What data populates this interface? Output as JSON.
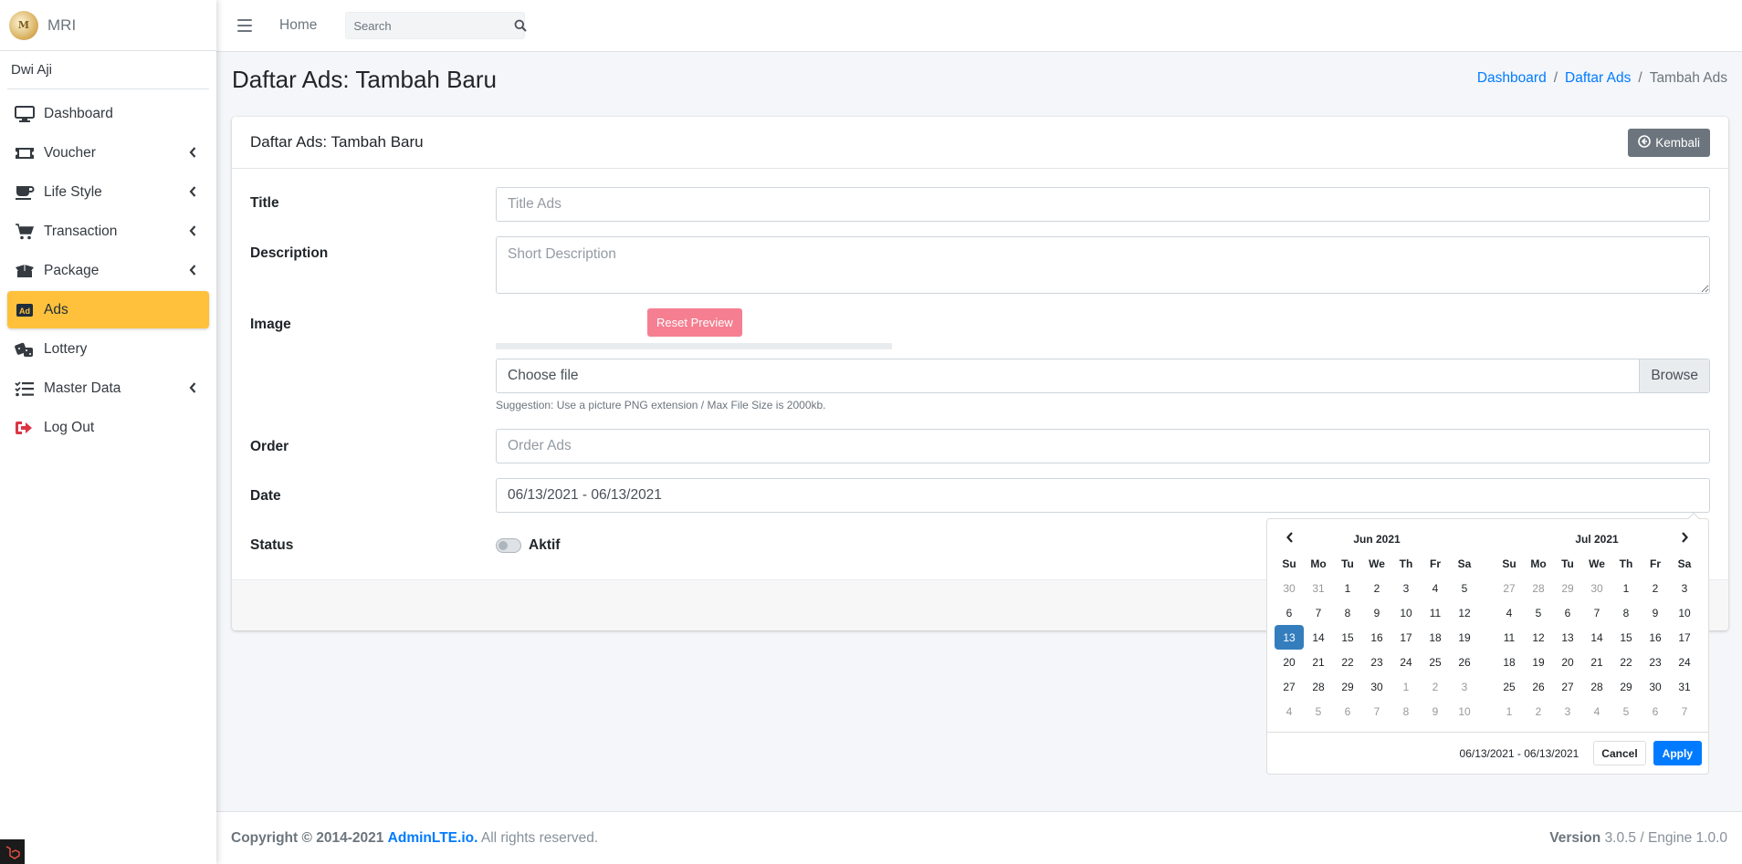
{
  "brand": {
    "name": "MRI",
    "logo_text": "M"
  },
  "user": {
    "name": "Dwi Aji"
  },
  "sidebar": {
    "items": [
      {
        "label": "Dashboard",
        "icon": "desktop-icon",
        "has_arrow": false
      },
      {
        "label": "Voucher",
        "icon": "ticket-icon",
        "has_arrow": true
      },
      {
        "label": "Life Style",
        "icon": "coffee-icon",
        "has_arrow": true
      },
      {
        "label": "Transaction",
        "icon": "cart-icon",
        "has_arrow": true
      },
      {
        "label": "Package",
        "icon": "box-open-icon",
        "has_arrow": true
      },
      {
        "label": "Ads",
        "icon": "ad-icon",
        "has_arrow": false,
        "active": true
      },
      {
        "label": "Lottery",
        "icon": "dice-icon",
        "has_arrow": false
      },
      {
        "label": "Master Data",
        "icon": "tasks-icon",
        "has_arrow": true
      },
      {
        "label": "Log Out",
        "icon": "sign-out-icon",
        "has_arrow": false
      }
    ]
  },
  "topbar": {
    "home_label": "Home",
    "search_placeholder": "Search"
  },
  "page": {
    "title": "Daftar Ads: Tambah Baru",
    "breadcrumb": [
      "Dashboard",
      "Daftar Ads",
      "Tambah Ads"
    ]
  },
  "card": {
    "title": "Daftar Ads: Tambah Baru",
    "back_label": "Kembali"
  },
  "form": {
    "title_label": "Title",
    "title_placeholder": "Title Ads",
    "description_label": "Description",
    "description_placeholder": "Short Description",
    "image_label": "Image",
    "reset_preview_label": "Reset Preview",
    "file_placeholder": "Choose file",
    "browse_label": "Browse",
    "file_hint": "Suggestion: Use a picture PNG extension / Max File Size is 2000kb.",
    "order_label": "Order",
    "order_placeholder": "Order Ads",
    "date_label": "Date",
    "date_value": "06/13/2021 - 06/13/2021",
    "status_label": "Status",
    "status_switch_label": "Aktif",
    "status_on": false
  },
  "datepicker": {
    "weekdays": [
      "Su",
      "Mo",
      "Tu",
      "We",
      "Th",
      "Fr",
      "Sa"
    ],
    "left": {
      "month": "Jun 2021",
      "weeks": [
        [
          {
            "d": "30",
            "off": true
          },
          {
            "d": "31",
            "off": true
          },
          {
            "d": "1"
          },
          {
            "d": "2"
          },
          {
            "d": "3"
          },
          {
            "d": "4"
          },
          {
            "d": "5"
          }
        ],
        [
          {
            "d": "6"
          },
          {
            "d": "7"
          },
          {
            "d": "8"
          },
          {
            "d": "9"
          },
          {
            "d": "10"
          },
          {
            "d": "11"
          },
          {
            "d": "12"
          }
        ],
        [
          {
            "d": "13",
            "active": true
          },
          {
            "d": "14"
          },
          {
            "d": "15"
          },
          {
            "d": "16"
          },
          {
            "d": "17"
          },
          {
            "d": "18"
          },
          {
            "d": "19"
          }
        ],
        [
          {
            "d": "20"
          },
          {
            "d": "21"
          },
          {
            "d": "22"
          },
          {
            "d": "23"
          },
          {
            "d": "24"
          },
          {
            "d": "25"
          },
          {
            "d": "26"
          }
        ],
        [
          {
            "d": "27"
          },
          {
            "d": "28"
          },
          {
            "d": "29"
          },
          {
            "d": "30"
          },
          {
            "d": "1",
            "off": true
          },
          {
            "d": "2",
            "off": true
          },
          {
            "d": "3",
            "off": true
          }
        ],
        [
          {
            "d": "4",
            "off": true
          },
          {
            "d": "5",
            "off": true
          },
          {
            "d": "6",
            "off": true
          },
          {
            "d": "7",
            "off": true
          },
          {
            "d": "8",
            "off": true
          },
          {
            "d": "9",
            "off": true
          },
          {
            "d": "10",
            "off": true
          }
        ]
      ]
    },
    "right": {
      "month": "Jul 2021",
      "weeks": [
        [
          {
            "d": "27",
            "off": true
          },
          {
            "d": "28",
            "off": true
          },
          {
            "d": "29",
            "off": true
          },
          {
            "d": "30",
            "off": true
          },
          {
            "d": "1"
          },
          {
            "d": "2"
          },
          {
            "d": "3"
          }
        ],
        [
          {
            "d": "4"
          },
          {
            "d": "5"
          },
          {
            "d": "6"
          },
          {
            "d": "7"
          },
          {
            "d": "8"
          },
          {
            "d": "9"
          },
          {
            "d": "10"
          }
        ],
        [
          {
            "d": "11"
          },
          {
            "d": "12"
          },
          {
            "d": "13"
          },
          {
            "d": "14"
          },
          {
            "d": "15"
          },
          {
            "d": "16"
          },
          {
            "d": "17"
          }
        ],
        [
          {
            "d": "18"
          },
          {
            "d": "19"
          },
          {
            "d": "20"
          },
          {
            "d": "21"
          },
          {
            "d": "22"
          },
          {
            "d": "23"
          },
          {
            "d": "24"
          }
        ],
        [
          {
            "d": "25"
          },
          {
            "d": "26"
          },
          {
            "d": "27"
          },
          {
            "d": "28"
          },
          {
            "d": "29"
          },
          {
            "d": "30"
          },
          {
            "d": "31"
          }
        ],
        [
          {
            "d": "1",
            "off": true
          },
          {
            "d": "2",
            "off": true
          },
          {
            "d": "3",
            "off": true
          },
          {
            "d": "4",
            "off": true
          },
          {
            "d": "5",
            "off": true
          },
          {
            "d": "6",
            "off": true
          },
          {
            "d": "7",
            "off": true
          }
        ]
      ]
    },
    "selected_range": "06/13/2021 - 06/13/2021",
    "cancel_label": "Cancel",
    "apply_label": "Apply"
  },
  "footer": {
    "copyright_prefix": "Copyright © 2014-2021",
    "link_text": "AdminLTE.io.",
    "rights": "All rights reserved.",
    "version_label": "Version",
    "version_value": "3.0.5 / Engine 1.0.0"
  },
  "colors": {
    "accent": "#ffc13b",
    "primary": "#007bff",
    "danger_light": "#f57f91",
    "secondary": "#6c757d",
    "calendar_active": "#357ebd"
  }
}
